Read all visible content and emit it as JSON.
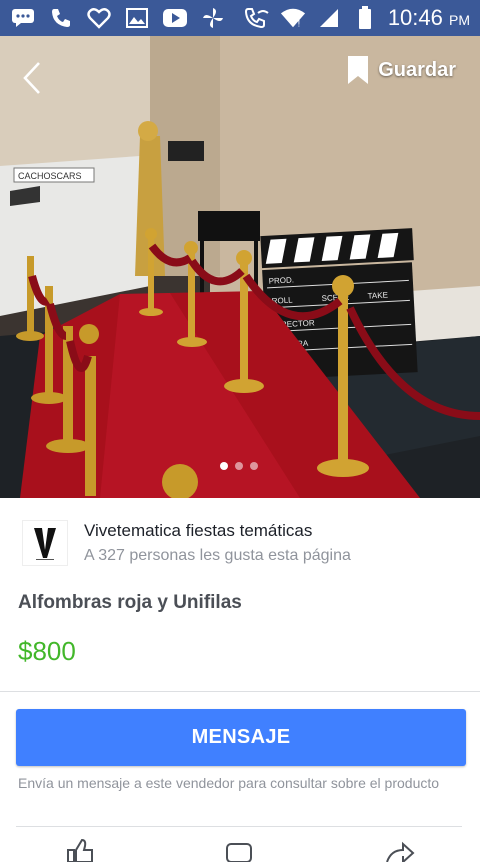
{
  "status_bar": {
    "time": "10:46",
    "ampm": "PM",
    "icons": [
      "chat-bubble-icon",
      "phone-icon",
      "heart-icon",
      "image-icon",
      "youtube-icon",
      "pinwheel-icon",
      "wifi-call-icon",
      "wifi-icon",
      "signal-icon",
      "battery-icon"
    ]
  },
  "hero": {
    "save_label": "Guardar",
    "image_description_icon": "red-carpet-photo",
    "page_count": 3,
    "active_page": 1,
    "photo_text": {
      "banner": "CACHOSCARS",
      "clapper_lines": [
        "PROD.",
        "ROLL",
        "SCENE",
        "TAKE",
        "DIRECTOR",
        "CAMERA"
      ]
    }
  },
  "seller": {
    "name": "Vivetematica fiestas temáticas",
    "likes": "A 327 personas les gusta esta página"
  },
  "listing": {
    "title": "Alfombras roja y Unifilas",
    "price": "$800"
  },
  "message_button": "MENSAJE",
  "hint": "Envía un mensaje a este vendedor para consultar sobre el producto",
  "colors": {
    "status_bar": "#3b5998",
    "button": "#4080ff",
    "price": "#42b72a"
  }
}
